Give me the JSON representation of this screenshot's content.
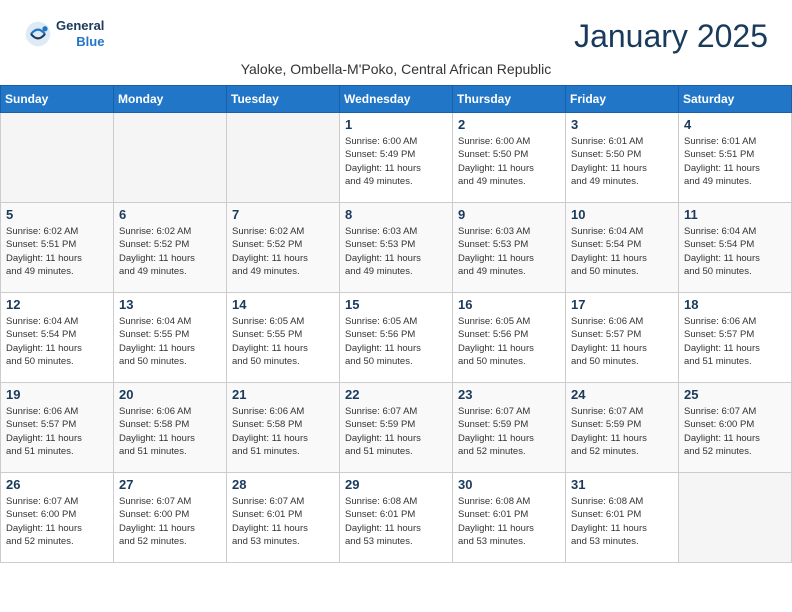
{
  "header": {
    "title": "January 2025",
    "location": "Yaloke, Ombella-M'Poko, Central African Republic",
    "logo_general": "General",
    "logo_blue": "Blue"
  },
  "days_of_week": [
    "Sunday",
    "Monday",
    "Tuesday",
    "Wednesday",
    "Thursday",
    "Friday",
    "Saturday"
  ],
  "weeks": [
    [
      {
        "day": "",
        "info": ""
      },
      {
        "day": "",
        "info": ""
      },
      {
        "day": "",
        "info": ""
      },
      {
        "day": "1",
        "info": "Sunrise: 6:00 AM\nSunset: 5:49 PM\nDaylight: 11 hours\nand 49 minutes."
      },
      {
        "day": "2",
        "info": "Sunrise: 6:00 AM\nSunset: 5:50 PM\nDaylight: 11 hours\nand 49 minutes."
      },
      {
        "day": "3",
        "info": "Sunrise: 6:01 AM\nSunset: 5:50 PM\nDaylight: 11 hours\nand 49 minutes."
      },
      {
        "day": "4",
        "info": "Sunrise: 6:01 AM\nSunset: 5:51 PM\nDaylight: 11 hours\nand 49 minutes."
      }
    ],
    [
      {
        "day": "5",
        "info": "Sunrise: 6:02 AM\nSunset: 5:51 PM\nDaylight: 11 hours\nand 49 minutes."
      },
      {
        "day": "6",
        "info": "Sunrise: 6:02 AM\nSunset: 5:52 PM\nDaylight: 11 hours\nand 49 minutes."
      },
      {
        "day": "7",
        "info": "Sunrise: 6:02 AM\nSunset: 5:52 PM\nDaylight: 11 hours\nand 49 minutes."
      },
      {
        "day": "8",
        "info": "Sunrise: 6:03 AM\nSunset: 5:53 PM\nDaylight: 11 hours\nand 49 minutes."
      },
      {
        "day": "9",
        "info": "Sunrise: 6:03 AM\nSunset: 5:53 PM\nDaylight: 11 hours\nand 49 minutes."
      },
      {
        "day": "10",
        "info": "Sunrise: 6:04 AM\nSunset: 5:54 PM\nDaylight: 11 hours\nand 50 minutes."
      },
      {
        "day": "11",
        "info": "Sunrise: 6:04 AM\nSunset: 5:54 PM\nDaylight: 11 hours\nand 50 minutes."
      }
    ],
    [
      {
        "day": "12",
        "info": "Sunrise: 6:04 AM\nSunset: 5:54 PM\nDaylight: 11 hours\nand 50 minutes."
      },
      {
        "day": "13",
        "info": "Sunrise: 6:04 AM\nSunset: 5:55 PM\nDaylight: 11 hours\nand 50 minutes."
      },
      {
        "day": "14",
        "info": "Sunrise: 6:05 AM\nSunset: 5:55 PM\nDaylight: 11 hours\nand 50 minutes."
      },
      {
        "day": "15",
        "info": "Sunrise: 6:05 AM\nSunset: 5:56 PM\nDaylight: 11 hours\nand 50 minutes."
      },
      {
        "day": "16",
        "info": "Sunrise: 6:05 AM\nSunset: 5:56 PM\nDaylight: 11 hours\nand 50 minutes."
      },
      {
        "day": "17",
        "info": "Sunrise: 6:06 AM\nSunset: 5:57 PM\nDaylight: 11 hours\nand 50 minutes."
      },
      {
        "day": "18",
        "info": "Sunrise: 6:06 AM\nSunset: 5:57 PM\nDaylight: 11 hours\nand 51 minutes."
      }
    ],
    [
      {
        "day": "19",
        "info": "Sunrise: 6:06 AM\nSunset: 5:57 PM\nDaylight: 11 hours\nand 51 minutes."
      },
      {
        "day": "20",
        "info": "Sunrise: 6:06 AM\nSunset: 5:58 PM\nDaylight: 11 hours\nand 51 minutes."
      },
      {
        "day": "21",
        "info": "Sunrise: 6:06 AM\nSunset: 5:58 PM\nDaylight: 11 hours\nand 51 minutes."
      },
      {
        "day": "22",
        "info": "Sunrise: 6:07 AM\nSunset: 5:59 PM\nDaylight: 11 hours\nand 51 minutes."
      },
      {
        "day": "23",
        "info": "Sunrise: 6:07 AM\nSunset: 5:59 PM\nDaylight: 11 hours\nand 52 minutes."
      },
      {
        "day": "24",
        "info": "Sunrise: 6:07 AM\nSunset: 5:59 PM\nDaylight: 11 hours\nand 52 minutes."
      },
      {
        "day": "25",
        "info": "Sunrise: 6:07 AM\nSunset: 6:00 PM\nDaylight: 11 hours\nand 52 minutes."
      }
    ],
    [
      {
        "day": "26",
        "info": "Sunrise: 6:07 AM\nSunset: 6:00 PM\nDaylight: 11 hours\nand 52 minutes."
      },
      {
        "day": "27",
        "info": "Sunrise: 6:07 AM\nSunset: 6:00 PM\nDaylight: 11 hours\nand 52 minutes."
      },
      {
        "day": "28",
        "info": "Sunrise: 6:07 AM\nSunset: 6:01 PM\nDaylight: 11 hours\nand 53 minutes."
      },
      {
        "day": "29",
        "info": "Sunrise: 6:08 AM\nSunset: 6:01 PM\nDaylight: 11 hours\nand 53 minutes."
      },
      {
        "day": "30",
        "info": "Sunrise: 6:08 AM\nSunset: 6:01 PM\nDaylight: 11 hours\nand 53 minutes."
      },
      {
        "day": "31",
        "info": "Sunrise: 6:08 AM\nSunset: 6:01 PM\nDaylight: 11 hours\nand 53 minutes."
      },
      {
        "day": "",
        "info": ""
      }
    ]
  ]
}
